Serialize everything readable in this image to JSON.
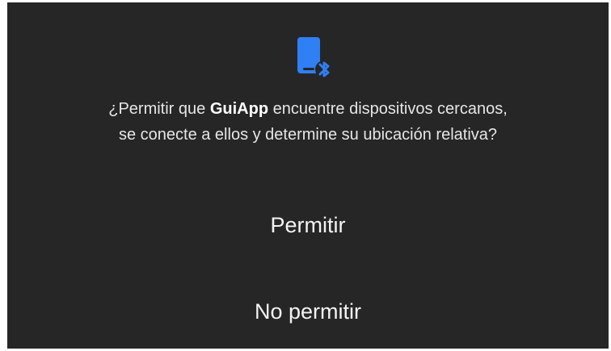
{
  "dialog": {
    "icon": "phone-bluetooth-icon",
    "accent_color": "#2f7ff5",
    "background_color": "#262626",
    "message": {
      "prefix": "¿Permitir que ",
      "app_name": "GuiApp",
      "suffix_line1": " encuentre dispositivos cercanos,",
      "line2": "se conecte a ellos y determine su ubicación relativa?"
    },
    "buttons": {
      "allow": "Permitir",
      "deny": "No permitir"
    }
  }
}
